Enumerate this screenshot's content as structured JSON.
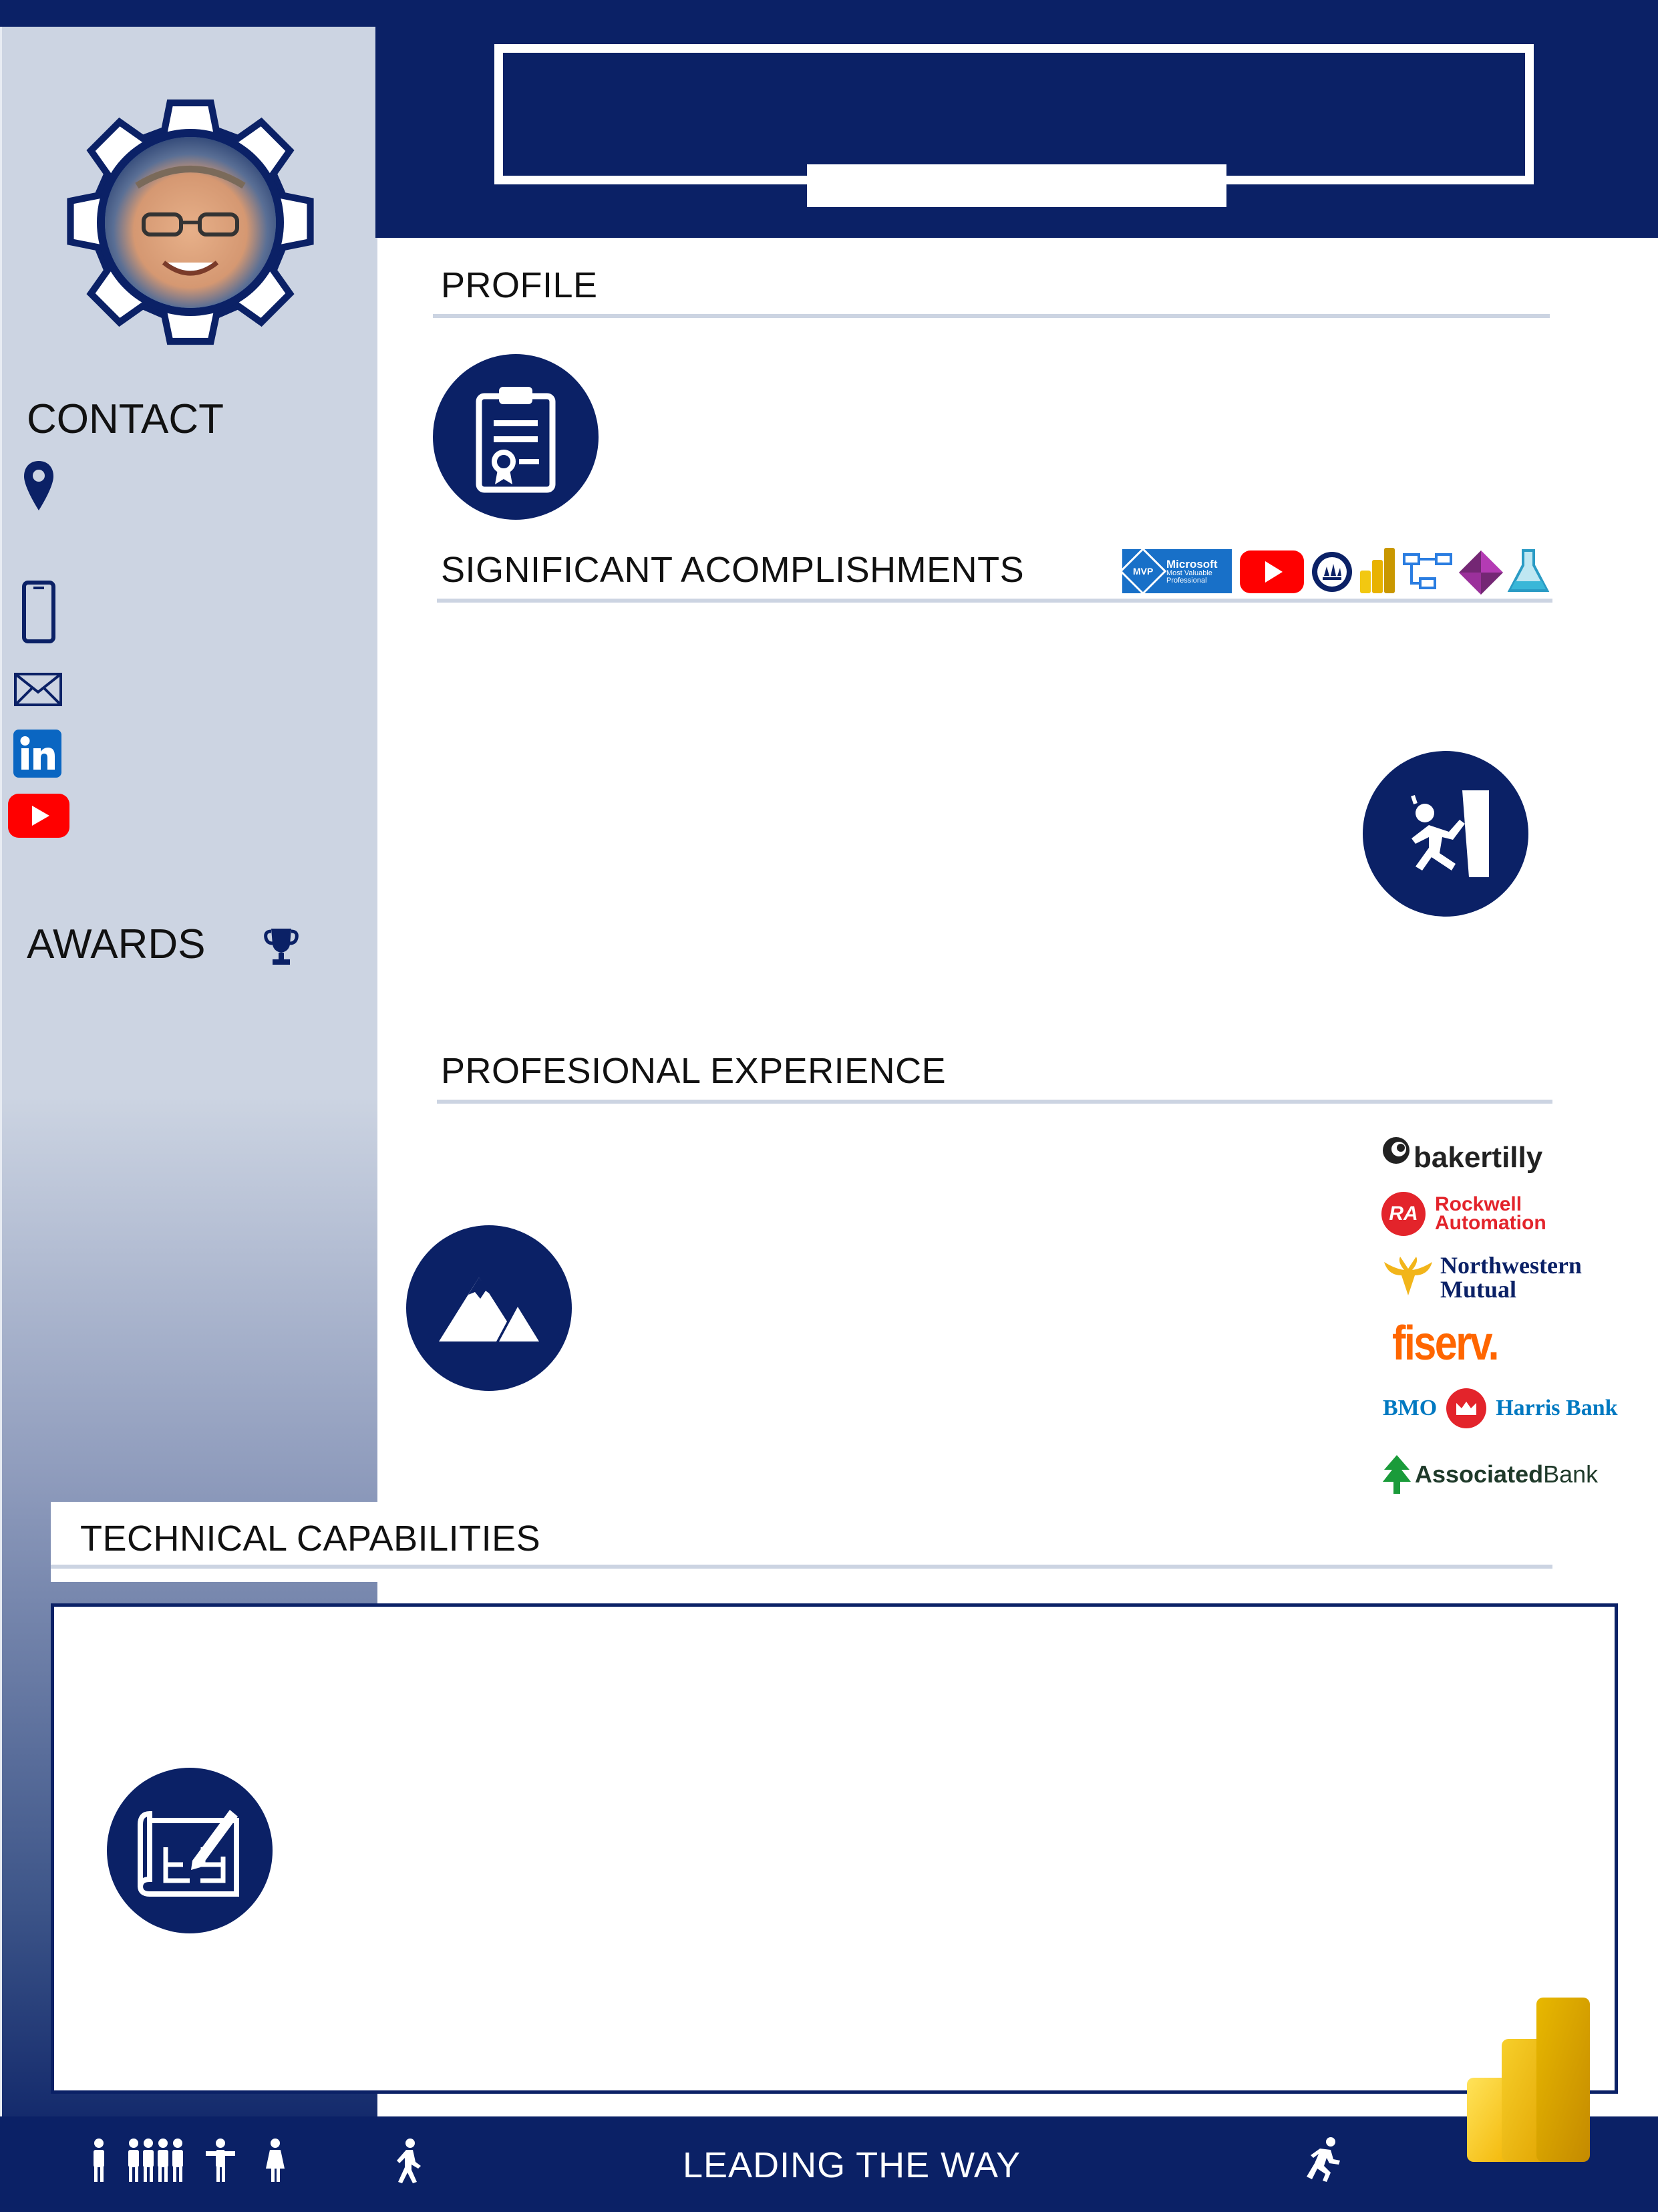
{
  "sections": {
    "profile": "PROFILE",
    "accomplishments": "SIGNIFICANT ACOMPLISHMENTS",
    "experience": "PROFESIONAL EXPERIENCE",
    "technical": "TECHNICAL CAPABILITIES"
  },
  "sidebar": {
    "contact": "CONTACT",
    "awards": "AWARDS",
    "contact_icons": [
      "location-pin-icon",
      "mobile-phone-icon",
      "envelope-icon",
      "linkedin-icon",
      "youtube-icon"
    ]
  },
  "badges": {
    "mvp_line1": "MVP",
    "mvp_line2": "Microsoft",
    "mvp_line3": "Most Valuable",
    "mvp_line4": "Professional"
  },
  "employers": {
    "bakertilly": "bakertilly",
    "rockwell_mark": "RA",
    "rockwell_1": "Rockwell",
    "rockwell_2": "Automation",
    "nm_1": "Northwestern",
    "nm_2": "Mutual",
    "fiserv": "fiserv.",
    "bmo": "BMO",
    "harris": "Harris Bank",
    "associated_1": "Associated",
    "associated_2": "Bank"
  },
  "footer": {
    "tagline": "LEADING THE WAY"
  },
  "colors": {
    "navy": "#0b2166",
    "sidebar": "#ccd4e2",
    "rule": "#ccd4e2",
    "youtube": "#ff0000",
    "linkedin": "#0a66c2"
  }
}
